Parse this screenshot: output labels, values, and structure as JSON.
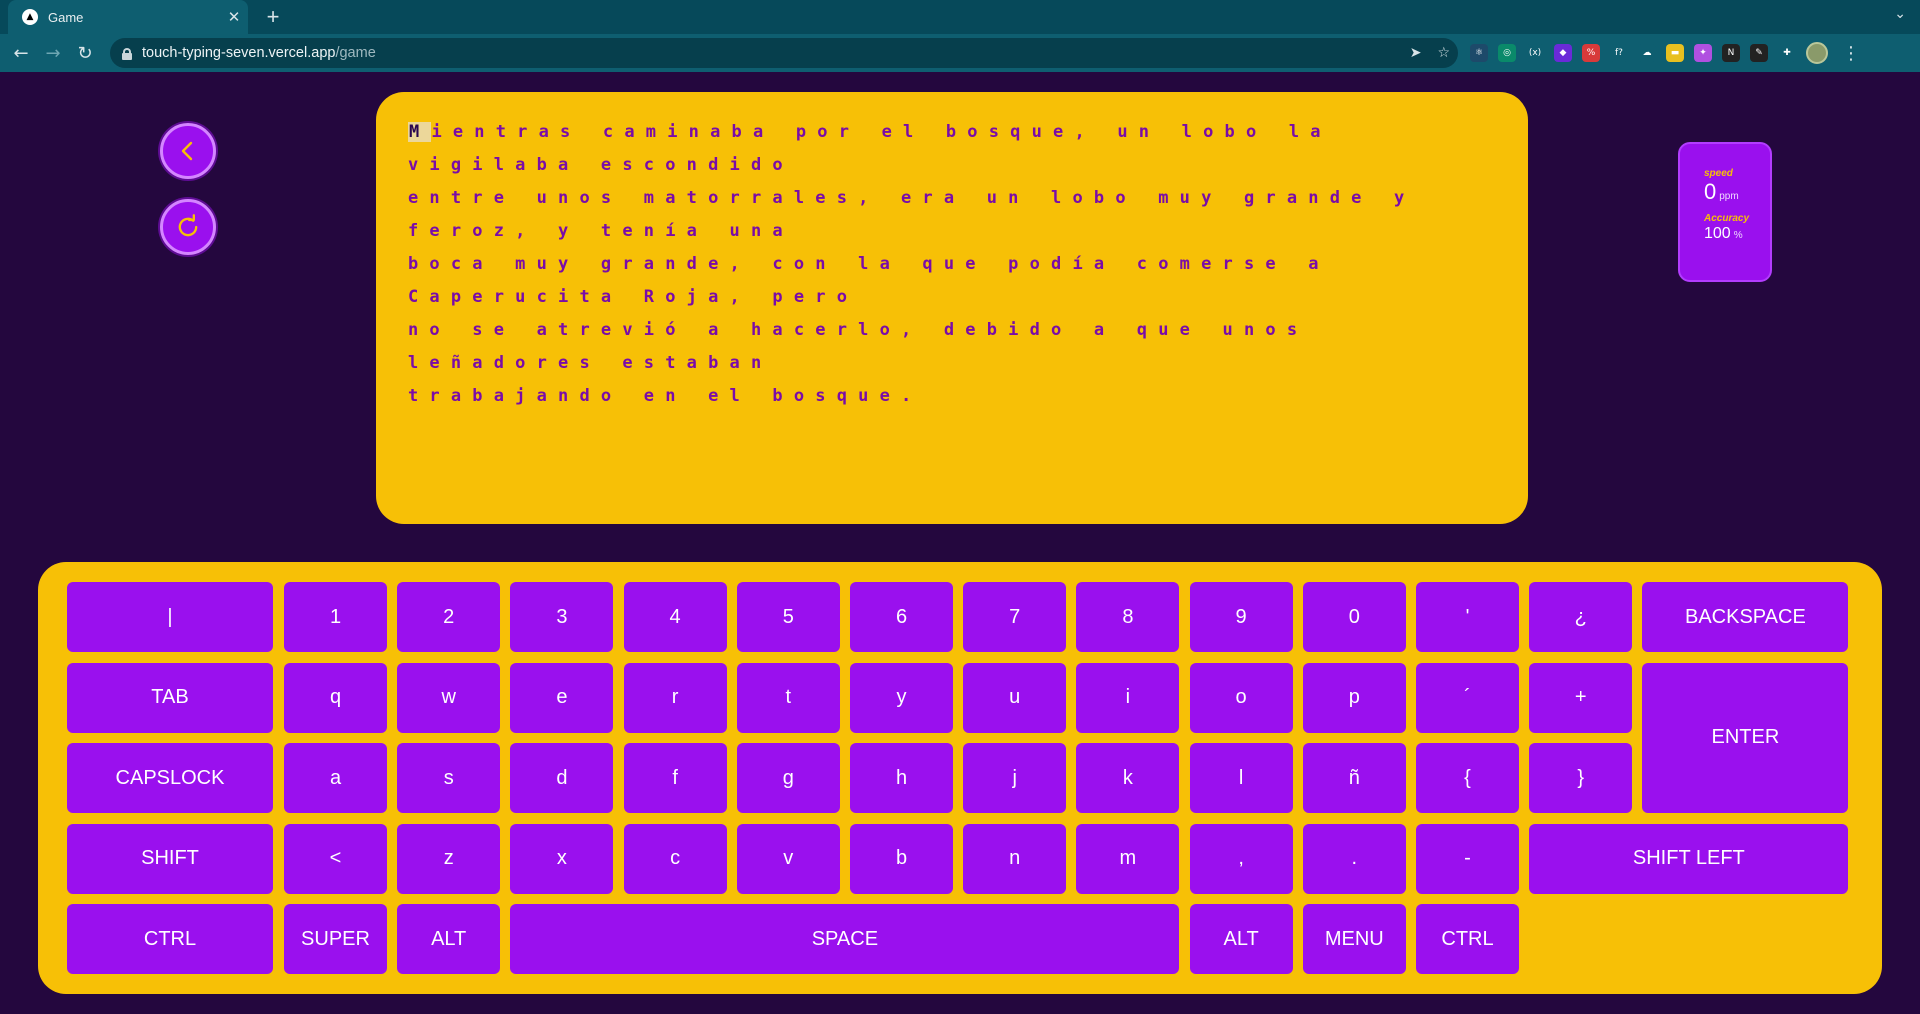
{
  "browser": {
    "tab_title": "Game",
    "tab_close": "✕",
    "new_tab": "+",
    "tab_dropdown": "⌄",
    "nav_back": "←",
    "nav_forward": "→",
    "nav_reload": "↻",
    "url_host": "touch-typing-seven.vercel.app",
    "url_path": "/game",
    "send_icon": "➤",
    "bookmark_icon": "☆",
    "menu": "⋮",
    "extensions": [
      {
        "name": "react-devtools-icon",
        "glyph": "⚛",
        "color": "#1d4a6a"
      },
      {
        "name": "grammarly-icon",
        "glyph": "◎",
        "color": "#0a8a6a"
      },
      {
        "name": "variables-icon",
        "glyph": "(x)",
        "color": "#0e5e70"
      },
      {
        "name": "extension-purple-icon",
        "glyph": "◆",
        "color": "#6a2ad8"
      },
      {
        "name": "percent-icon",
        "glyph": "%",
        "color": "#d83a3a"
      },
      {
        "name": "formula-icon",
        "glyph": "f?",
        "color": "#0e5e70"
      },
      {
        "name": "cloud-icon",
        "glyph": "☁",
        "color": "#0e5e70"
      },
      {
        "name": "sticky-note-icon",
        "glyph": "▬",
        "color": "#e8c020"
      },
      {
        "name": "magic-icon",
        "glyph": "✦",
        "color": "#b050e0"
      },
      {
        "name": "notion-icon",
        "glyph": "N",
        "color": "#222222"
      },
      {
        "name": "pen-icon",
        "glyph": "✎",
        "color": "#222222"
      },
      {
        "name": "puzzle-icon",
        "glyph": "✚",
        "color": "#0e5e70"
      }
    ]
  },
  "game": {
    "cursor_char": "M",
    "text": "ientras caminaba por el bosque, un lobo la vigilaba escondido\nentre unos matorrales, era un lobo muy grande y feroz, y tenía una\nboca muy grande, con la que podía comerse a Caperucita Roja, pero\nno se atrevió a hacerlo, debido a que unos leñadores estaban\ntrabajando en el bosque."
  },
  "stats": {
    "speed_label": "speed",
    "speed_value": "0",
    "speed_unit": "ppm",
    "accuracy_label": "Accuracy",
    "accuracy_value": "100",
    "accuracy_unit": "%"
  },
  "keyboard": {
    "rows": [
      [
        "|",
        "1",
        "2",
        "3",
        "4",
        "5",
        "6",
        "7",
        "8",
        "9",
        "0",
        "'",
        "¿",
        "BACKSPACE"
      ],
      [
        "TAB",
        "q",
        "w",
        "e",
        "r",
        "t",
        "y",
        "u",
        "i",
        "o",
        "p",
        "´",
        "+",
        "ENTER"
      ],
      [
        "CAPSLOCK",
        "a",
        "s",
        "d",
        "f",
        "g",
        "h",
        "j",
        "k",
        "l",
        "ñ",
        "{",
        "}"
      ],
      [
        "SHIFT",
        "<",
        "z",
        "x",
        "c",
        "v",
        "b",
        "n",
        "m",
        ",",
        ".",
        "-",
        "SHIFT LEFT"
      ],
      [
        "CTRL",
        "SUPER",
        "ALT",
        "SPACE",
        "ALT",
        "MENU",
        "CTRL"
      ]
    ]
  }
}
